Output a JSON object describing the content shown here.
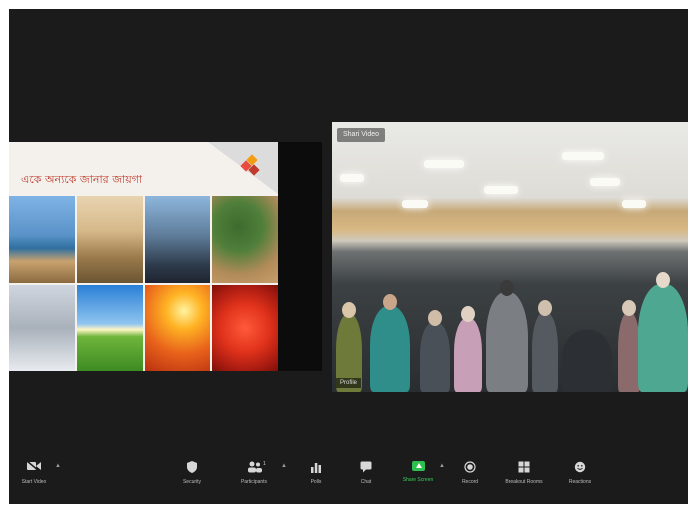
{
  "slide": {
    "title": "একে অন্যকে জানার জায়গা"
  },
  "camera": {
    "name_chip": "Shari Video",
    "participant_label": "Profile"
  },
  "toolbar": {
    "start_video": "Start Video",
    "security": "Security",
    "participants": "Participants",
    "participants_count": "1",
    "polls": "Polls",
    "chat": "Chat",
    "share_screen": "Share Screen",
    "record": "Record",
    "breakout_rooms": "Breakout Rooms",
    "reactions": "Reactions"
  },
  "colors": {
    "window_bg": "#1b1b1b",
    "share_green": "#2fbf4e",
    "slide_title_red": "#c0392b"
  },
  "icons": {
    "video": "video-camera-icon",
    "security": "shield-icon",
    "participants": "participants-icon",
    "polls": "bar-chart-icon",
    "chat": "chat-bubble-icon",
    "share": "share-screen-icon",
    "record": "record-icon",
    "breakout": "breakout-rooms-icon",
    "reactions": "smiley-icon"
  }
}
